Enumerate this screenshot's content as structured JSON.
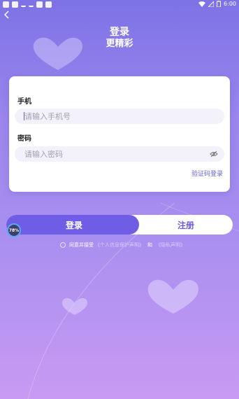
{
  "status_bar": {
    "time": "6:00"
  },
  "header": {
    "title_line1": "登录",
    "title_line2": "更精彩"
  },
  "form": {
    "phone_label": "手机",
    "phone_placeholder": "请输入手机号",
    "password_label": "密码",
    "password_placeholder": "请输入密码",
    "sms_login_link": "验证码登录"
  },
  "tabs": {
    "login": "登录",
    "register": "注册"
  },
  "badge": {
    "percent": "78%"
  },
  "agreement": {
    "prefix": "同意并接受",
    "privacy_link": "《个人信息保护声明》",
    "and": "和",
    "policy_link": "《隐私声明》"
  },
  "colors": {
    "accent": "#6f5de6",
    "link": "#6a64d8"
  }
}
